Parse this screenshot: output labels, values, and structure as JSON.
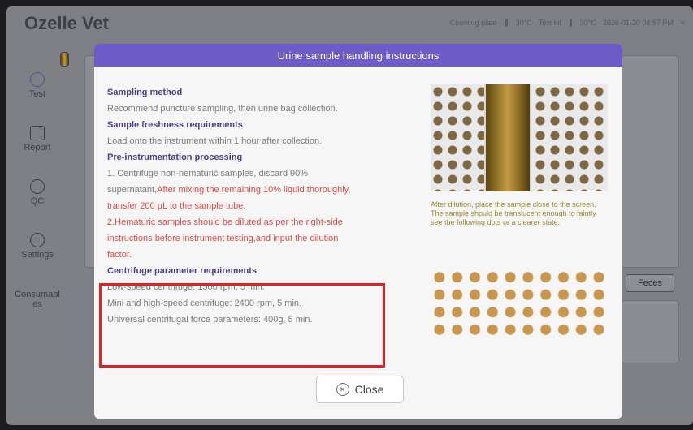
{
  "app": {
    "title": "Ozelle Vet",
    "status": {
      "counting_plate_label": "Counting plate",
      "counting_plate_temp": "30°C",
      "test_kit_label": "Test kit",
      "test_kit_temp": "30°C",
      "datetime": "2026-01-20 04:57 PM"
    }
  },
  "sidebar": {
    "items": [
      {
        "label": "Test",
        "icon": "test-icon"
      },
      {
        "label": "Report",
        "icon": "report-icon"
      },
      {
        "label": "QC",
        "icon": "qc-icon"
      },
      {
        "label": "Settings",
        "icon": "settings-icon"
      },
      {
        "label": "Consumables",
        "label_line1": "Consumabl",
        "label_line2": "es",
        "icon": "consumables-icon"
      }
    ]
  },
  "background": {
    "sample_type_button": "Feces"
  },
  "dialog": {
    "title": "Urine sample handling instructions",
    "lines": [
      "Sampling method",
      "Recommend puncture sampling, then urine bag collection.",
      "Sample freshness requirements",
      "Load onto the instrument within 1 hour after collection.",
      "Pre-instrumentation processing",
      "1. Centrifuge non-hematuric samples, discard 90%",
      "supernatant,",
      "After mixing the remaining 10% liquid thoroughly,",
      "transfer 200 μL to the sample tube.",
      "2.Hematuric samples should be diluted as per the right-side",
      "instructions before instrument testing,and input the dilution",
      "factor.",
      "Centrifuge parameter requirements",
      "Low-speed centrifuge: 1500 rpm, 5 min.",
      "Mini and high-speed centrifuge: 2400 rpm, 5 min.",
      "Universal centrifugal force parameters: 400g, 5 min."
    ],
    "note": "After dilution, place the sample close to the screen. The sample should be translucent enough to faintly see the following dots or a clearer state.",
    "close_label": "Close"
  },
  "colors": {
    "header": "#6d5bc7",
    "heading_text": "#4a3e85",
    "body_text": "#7a7a7a",
    "warning_text": "#d94a4a",
    "highlight_border": "#e12222",
    "note_text": "#a0852f",
    "dot_color": "#c8974d"
  }
}
